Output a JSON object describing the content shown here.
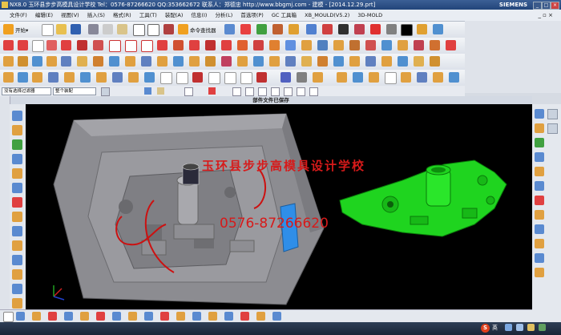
{
  "window": {
    "title": "NX8.0 玉环县步步高模具设计学校  Tel：0576-87266620 QQ:353662672  联系人：郑德忠  http://www.bbgmj.com - 建模 - [2014.12.29.prt]",
    "brand": "SIEMENS",
    "btn_min": "_",
    "btn_max": "□",
    "btn_close": "×"
  },
  "menu": {
    "items": [
      "文件(F)",
      "编辑(E)",
      "视图(V)",
      "插入(S)",
      "格式(R)",
      "工具(T)",
      "装配(A)",
      "信息(I)",
      "分析(L)",
      "首选项(P)",
      "GC 工具箱",
      "XB_MOULD(V5.2)",
      "3D-MOLD"
    ],
    "window_controls": "_ ▫ ×"
  },
  "toolbar1": {
    "start_label": "开始▾",
    "cmd_finder_label": "命令查找器"
  },
  "filterbar": {
    "filter_select": "没有选择过滤器",
    "assembly_select": "整个装配"
  },
  "status": {
    "message": "部件文件已保存"
  },
  "viewport": {
    "watermark_name": "玉环县步步高模具设计学校",
    "watermark_phone": "0576-87266620",
    "colors": {
      "background": "#000000",
      "mold_gray": "#8f8f94",
      "part_green": "#1fd41f",
      "annotation_red": "#cc1111",
      "highlight_blue": "#2f8ee8"
    }
  },
  "taskbar": {
    "ime_logo": "S",
    "ime_label": "英",
    "icons": [
      "sogou-icon",
      "network-icon",
      "volume-icon",
      "clock-icon"
    ]
  }
}
